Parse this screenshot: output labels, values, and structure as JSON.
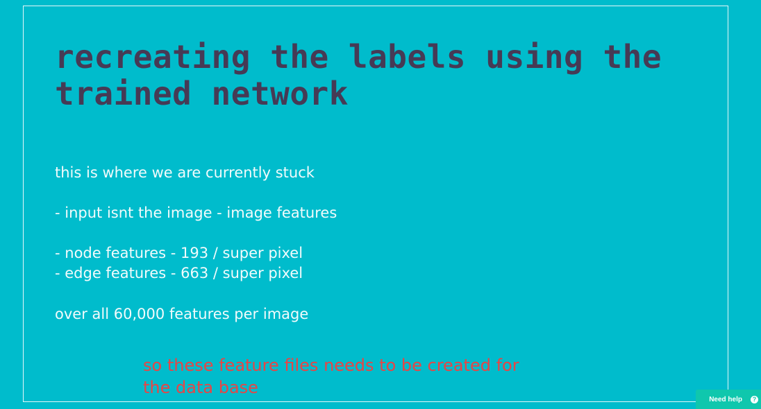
{
  "slide": {
    "title": "recreating the labels using the\ntrained network",
    "lines": [
      "this is where we are currently stuck",
      "- input isnt the image - image features",
      "- node features - 193 / super pixel",
      "- edge features - 663 / super pixel",
      "over all 60,000 features per image"
    ],
    "annotation": [
      "so these feature files needs to be created for",
      "the data base"
    ]
  },
  "help_widget": {
    "label": "Need help",
    "icon": "question-icon",
    "icon_glyph": "?"
  },
  "colors": {
    "background": "#00bccc",
    "title": "#463a55",
    "body_text": "#f2fbfc",
    "annotation": "#e84545",
    "help_button": "#0fc7ad"
  }
}
